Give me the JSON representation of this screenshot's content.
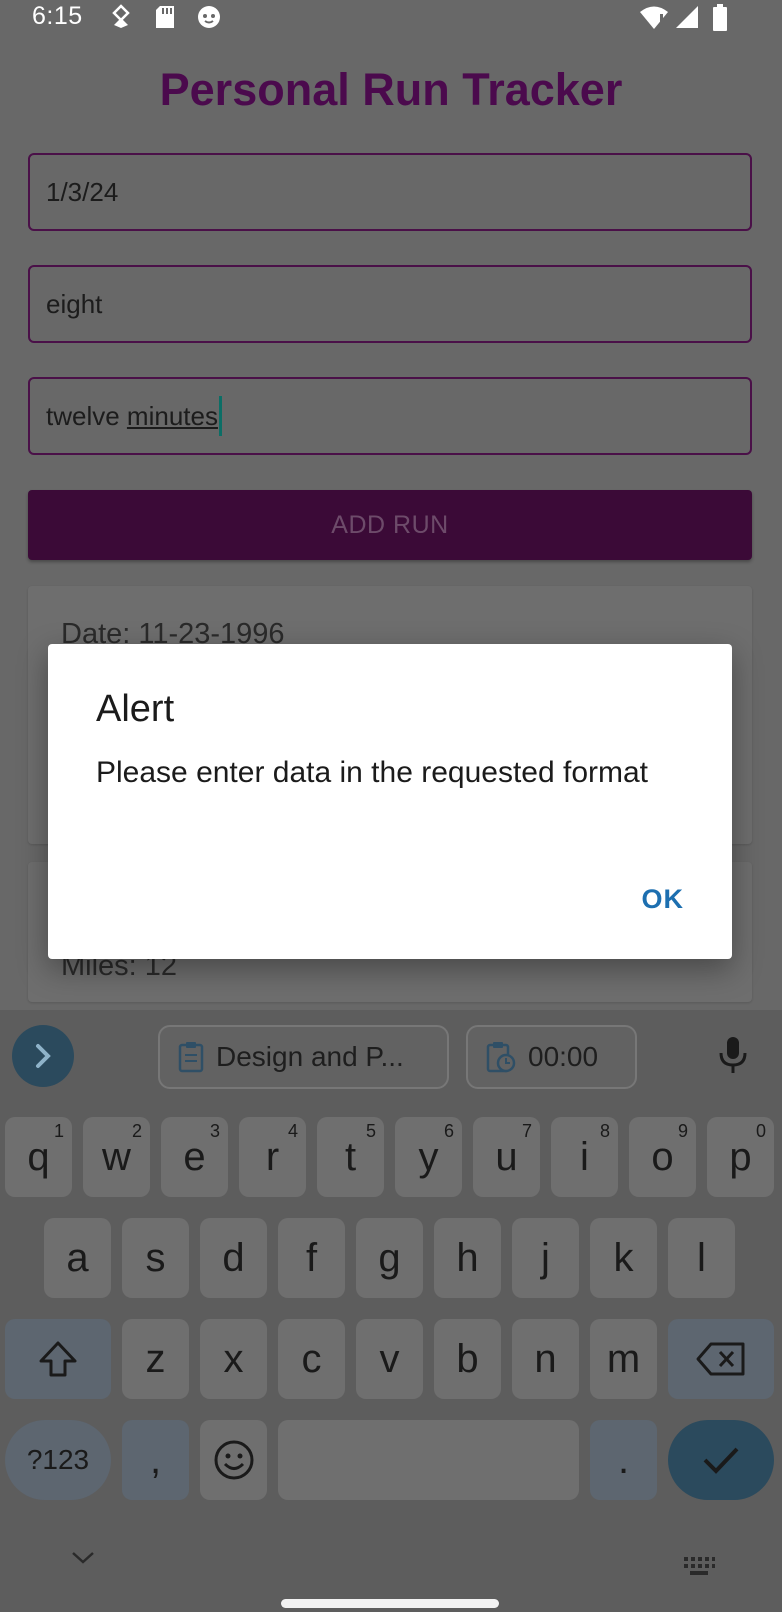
{
  "status_bar": {
    "time": "6:15",
    "left_icons": [
      "data-saver-icon",
      "sd-card-icon",
      "cat-face-icon"
    ],
    "right_icons": [
      "wifi-icon",
      "signal-icon",
      "battery-icon"
    ]
  },
  "app": {
    "title": "Personal Run Tracker",
    "fields": {
      "date_value": "1/3/24",
      "distance_value": "eight",
      "time_prefix": "twelve ",
      "time_composing": "minutes"
    },
    "add_button_label": "ADD RUN",
    "runs": [
      {
        "date_label": "Date: 11-23-1996"
      },
      {
        "miles_label": "Miles: 12"
      }
    ]
  },
  "dialog": {
    "title": "Alert",
    "message": "Please enter data in the requested format",
    "ok_label": "OK"
  },
  "keyboard": {
    "suggestions": [
      "Design and P...",
      "00:00"
    ],
    "row1": [
      {
        "k": "q",
        "n": "1"
      },
      {
        "k": "w",
        "n": "2"
      },
      {
        "k": "e",
        "n": "3"
      },
      {
        "k": "r",
        "n": "4"
      },
      {
        "k": "t",
        "n": "5"
      },
      {
        "k": "y",
        "n": "6"
      },
      {
        "k": "u",
        "n": "7"
      },
      {
        "k": "i",
        "n": "8"
      },
      {
        "k": "o",
        "n": "9"
      },
      {
        "k": "p",
        "n": "0"
      }
    ],
    "row2": [
      "a",
      "s",
      "d",
      "f",
      "g",
      "h",
      "j",
      "k",
      "l"
    ],
    "row3": [
      "z",
      "x",
      "c",
      "v",
      "b",
      "n",
      "m"
    ],
    "symbols_label": "?123",
    "comma": ",",
    "period": ".",
    "colors": {
      "accent_blue": "#1d6fb0",
      "title_purple": "#4b0a4d",
      "button_purple": "#3b0a37"
    }
  }
}
